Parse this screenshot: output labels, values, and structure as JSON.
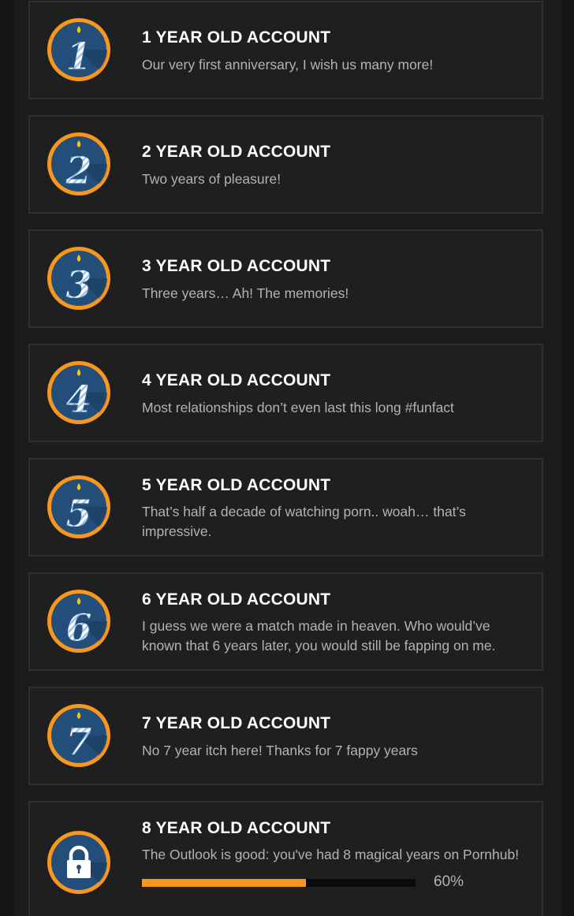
{
  "colors": {
    "accent": "#f7971d",
    "badge_blue": "#244e7a",
    "background": "#1f1f1f",
    "title": "#ffffff",
    "description": "#b3b3b3"
  },
  "achievements": [
    {
      "numeral": "1",
      "icon": "candle-number-1-icon",
      "title": "1 YEAR OLD ACCOUNT",
      "description": "Our very first anniversary, I wish us many more!"
    },
    {
      "numeral": "2",
      "icon": "candle-number-2-icon",
      "title": "2 YEAR OLD ACCOUNT",
      "description": "Two years of pleasure!"
    },
    {
      "numeral": "3",
      "icon": "candle-number-3-icon",
      "title": "3 YEAR OLD ACCOUNT",
      "description": "Three years… Ah! The memories!"
    },
    {
      "numeral": "4",
      "icon": "candle-number-4-icon",
      "title": "4 YEAR OLD ACCOUNT",
      "description": "Most relationships don’t even last this long #funfact"
    },
    {
      "numeral": "5",
      "icon": "candle-number-5-icon",
      "title": "5 YEAR OLD ACCOUNT",
      "description": "That’s half a decade of watching porn.. woah… that’s impressive."
    },
    {
      "numeral": "6",
      "icon": "candle-number-6-icon",
      "title": "6 YEAR OLD ACCOUNT",
      "description": "I guess we were a match made in heaven. Who would’ve known that 6 years later, you would still be fapping on me."
    },
    {
      "numeral": "7",
      "icon": "candle-number-7-icon",
      "title": "7 YEAR OLD ACCOUNT",
      "description": "No 7 year itch here! Thanks for 7 fappy years"
    }
  ],
  "locked_achievement": {
    "icon": "padlock-icon",
    "title": "8 YEAR OLD ACCOUNT",
    "description": "The Outlook is good: you've had 8 magical years on Pornhub!",
    "progress_fraction": 0.6,
    "progress_label": "60%"
  }
}
